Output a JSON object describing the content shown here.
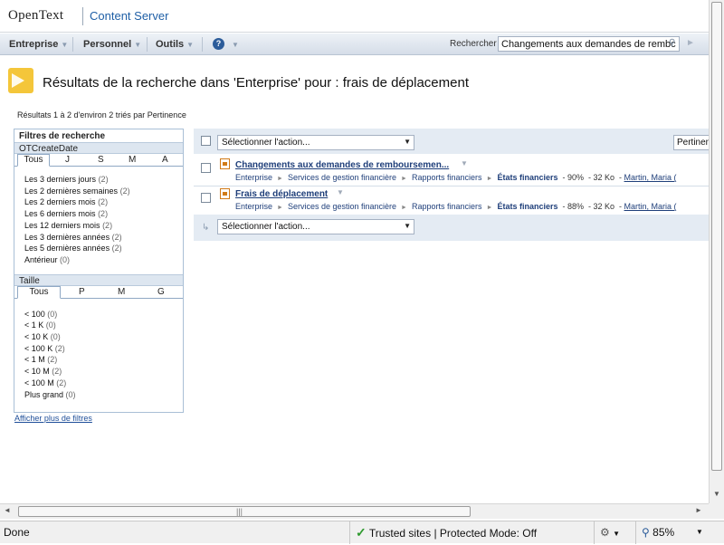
{
  "header": {
    "brand_opentext": "OpenText",
    "brand_product": "Content Server"
  },
  "nav": {
    "items": [
      "Entreprise",
      "Personnel",
      "Outils"
    ],
    "help": "?",
    "search_label": "Rechercher",
    "search_value": "Changements aux demandes de rembc"
  },
  "page": {
    "title": "Résultats de la recherche dans 'Enterprise' pour : frais de déplacement",
    "result_count": "Résultats 1 à 2 d'environ 2 triés par Pertinence"
  },
  "filters": {
    "header": "Filtres de recherche",
    "date_section": {
      "title": "OTCreateDate",
      "tabs": [
        "Tous",
        "J",
        "S",
        "M",
        "A"
      ],
      "active_tab": "Tous",
      "items": [
        {
          "label": "Les 3 derniers jours",
          "count": "(2)"
        },
        {
          "label": "Les 2 dernières semaines",
          "count": "(2)"
        },
        {
          "label": "Les 2 derniers mois",
          "count": "(2)"
        },
        {
          "label": "Les 6 derniers mois",
          "count": "(2)"
        },
        {
          "label": "Les 12 derniers mois",
          "count": "(2)"
        },
        {
          "label": "Les 3 dernières années",
          "count": "(2)"
        },
        {
          "label": "Les 5 dernières années",
          "count": "(2)"
        },
        {
          "label": "Antérieur",
          "count": "(0)"
        }
      ]
    },
    "size_section": {
      "title": "Taille",
      "tabs": [
        "Tous",
        "P",
        "M",
        "G"
      ],
      "active_tab": "Tous",
      "items": [
        {
          "label": "< 100",
          "count": "(0)"
        },
        {
          "label": "< 1 K",
          "count": "(0)"
        },
        {
          "label": "< 10 K",
          "count": "(0)"
        },
        {
          "label": "< 100 K",
          "count": "(2)"
        },
        {
          "label": "< 1 M",
          "count": "(2)"
        },
        {
          "label": "< 10 M",
          "count": "(2)"
        },
        {
          "label": "< 100 M",
          "count": "(2)"
        },
        {
          "label": "Plus grand",
          "count": "(0)"
        }
      ]
    },
    "more_link": "Afficher plus de filtres"
  },
  "results": {
    "action_select": "Sélectionner l'action...",
    "sort_select": "Pertinence",
    "rows": [
      {
        "title": "Changements aux demandes de remboursemen...",
        "path": [
          "Enterprise",
          "Services de gestion financière",
          "Rapports financiers"
        ],
        "location": "États financiers",
        "relevance": "90%",
        "size": "32 Ko",
        "owner": "Martin, Maria ("
      },
      {
        "title": "Frais de déplacement",
        "path": [
          "Enterprise",
          "Services de gestion financière",
          "Rapports financiers"
        ],
        "location": "États financiers",
        "relevance": "88%",
        "size": "32 Ko",
        "owner": "Martin, Maria ("
      }
    ],
    "path_sep": "►"
  },
  "statusbar": {
    "done": "Done",
    "zone": "Trusted sites | Protected Mode: Off",
    "zoom": "85%"
  },
  "colors": {
    "brand_blue": "#1f5fa6",
    "link_blue": "#1f3f7a",
    "panel_bg": "#e4ebf3",
    "trusted_check": "#2e9a2e"
  }
}
